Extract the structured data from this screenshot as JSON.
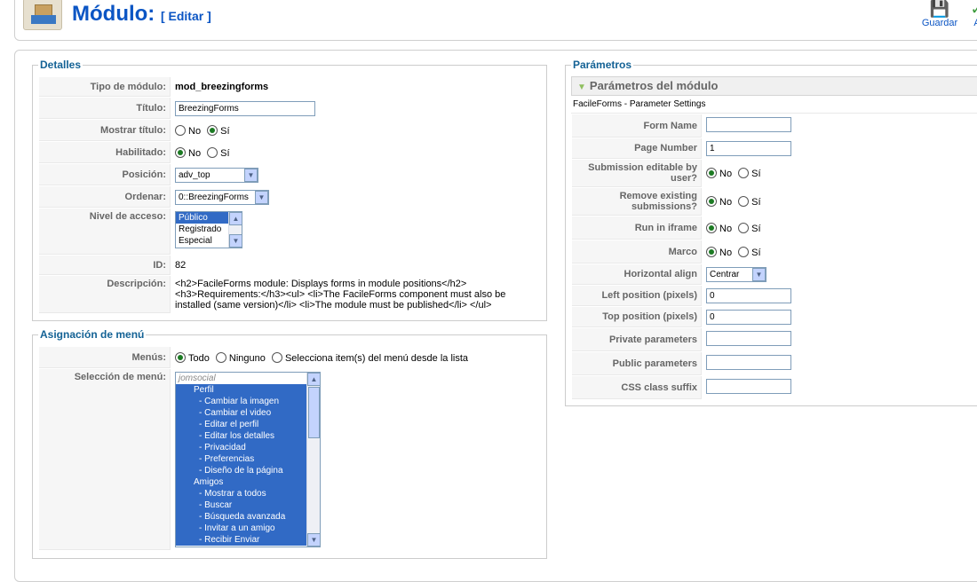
{
  "header": {
    "title": "Módulo:",
    "subtitle": "[ Editar ]",
    "toolbar": [
      {
        "label": "Guardar",
        "icon": "save-icon"
      },
      {
        "label": "A",
        "icon": "apply-icon"
      }
    ]
  },
  "details": {
    "legend": "Detalles",
    "module_type_label": "Tipo de módulo:",
    "module_type_value": "mod_breezingforms",
    "title_label": "Título:",
    "title_value": "BreezingForms",
    "show_title_label": "Mostrar título:",
    "no": "No",
    "yes": "Sí",
    "enabled_label": "Habilitado:",
    "position_label": "Posición:",
    "position_value": "adv_top",
    "order_label": "Ordenar:",
    "order_value": "0::BreezingForms",
    "access_label": "Nivel de acceso:",
    "access_options": [
      "Público",
      "Registrado",
      "Especial"
    ],
    "id_label": "ID:",
    "id_value": "82",
    "description_label": "Descripción:",
    "description_value": "<h2>FacileForms module: Displays forms in module positions</h2> <h3>Requirements:</h3><ul> <li>The FacileForms component must also be installed (same version)</li> <li>The module must be published</li> </ul>"
  },
  "menu_assignment": {
    "legend": "Asignación de menú",
    "menus_label": "Menús:",
    "opt_all": "Todo",
    "opt_none": "Ninguno",
    "opt_select": "Selecciona item(s) del menú desde la lista",
    "selection_label": "Selección de menú:",
    "items": [
      "jomsocial",
      "Perfil",
      "- Cambiar la imagen",
      "- Cambiar el video",
      "- Editar el perfil",
      "- Editar los detalles",
      "- Privacidad",
      "- Preferencias",
      "- Diseño de la página",
      "Amigos",
      "- Mostrar a todos",
      "- Buscar",
      "- Búsqueda avanzada",
      "- Invitar a un amigo",
      "- Recibir Enviar"
    ]
  },
  "parameters": {
    "legend": "Parámetros",
    "panel_title": "Parámetros del módulo",
    "note": "FacileForms - Parameter Settings",
    "no": "No",
    "yes": "Sí",
    "form_name_label": "Form Name",
    "form_name_value": "",
    "page_number_label": "Page Number",
    "page_number_value": "1",
    "submission_editable_label": "Submission editable by user?",
    "remove_existing_label": "Remove existing submissions?",
    "run_iframe_label": "Run in iframe",
    "frame_label": "Marco",
    "horizontal_align_label": "Horizontal align",
    "horizontal_align_value": "Centrar",
    "left_position_label": "Left position (pixels)",
    "left_position_value": "0",
    "top_position_label": "Top position (pixels)",
    "top_position_value": "0",
    "private_params_label": "Private parameters",
    "private_params_value": "",
    "public_params_label": "Public parameters",
    "public_params_value": "",
    "css_suffix_label": "CSS class suffix",
    "css_suffix_value": ""
  }
}
